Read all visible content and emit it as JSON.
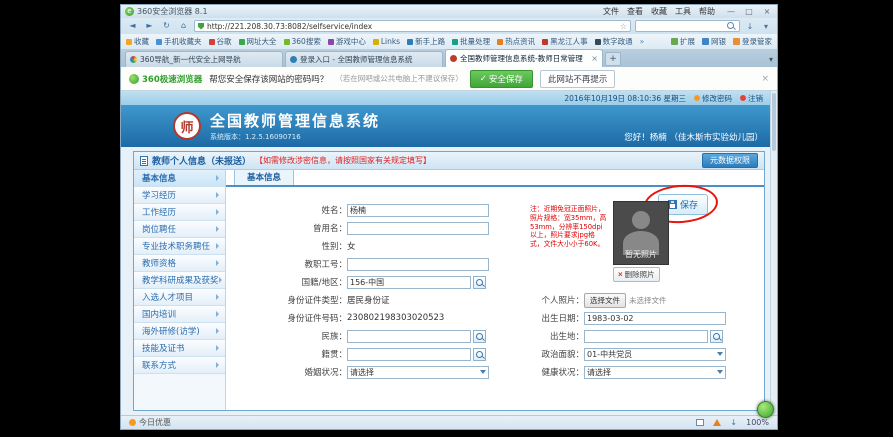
{
  "icons": {
    "back": "◄",
    "forward": "►",
    "refresh": "↻",
    "home": "⌂",
    "star": "☆",
    "min": "—",
    "max": "□",
    "close": "×",
    "plus": "+",
    "caret": "▾",
    "check": "✓",
    "x": "×",
    "download": "↓",
    "chevrons": "»"
  },
  "chrome": {
    "window_title": "360安全浏览器 8.1",
    "menus": [
      "文件",
      "查看",
      "收藏",
      "工具",
      "帮助"
    ],
    "url": "http://221.208.30.73:8082/selfservice/index",
    "bookmarks": [
      "收藏",
      "手机收藏夹",
      "谷歌",
      "网址大全",
      "360搜索",
      "游戏中心",
      "Links",
      "新手上路",
      "批量处理",
      "热点资讯",
      "黑龙江人事",
      "数字政通"
    ],
    "bookmark_tools": [
      "扩展",
      "网银",
      "登录管家"
    ],
    "tabs": [
      {
        "label": "360导航_新一代安全上网导航"
      },
      {
        "label": "登录入口 - 全国教师管理信息系统"
      },
      {
        "label": "全国教师管理信息系统-教师日常管理"
      }
    ],
    "notify": {
      "brand": "360极速浏览器",
      "message": "帮您安全保存该网站的密码吗？",
      "hint": "（若在网吧或公共电脑上不建议保存）",
      "save_btn": "安全保存",
      "dismiss_btn": "此网站不再提示"
    },
    "status_left": "今日优惠",
    "zoom": "100%"
  },
  "site": {
    "title": "全国教师管理信息系统",
    "version": "系统版本：1.2.5.16090716",
    "datetime": "2016年10月19日 08:10:36 星期三",
    "change_pwd": "修改密码",
    "logout": "注销",
    "welcome": "您好！杨楠 （佳木斯市实验幼儿园）"
  },
  "panel": {
    "title": "教师个人信息（未报送）",
    "notice": "【如需修改涉密信息，请按照国家有关规定填写】",
    "meta_btn": "元数据权限",
    "menu": [
      "基本信息",
      "学习经历",
      "工作经历",
      "岗位聘任",
      "专业技术职务聘任",
      "教师资格",
      "教学科研成果及获奖",
      "入选人才项目",
      "国内培训",
      "海外研修(访学)",
      "技能及证书",
      "联系方式"
    ],
    "tab": "基本信息",
    "save_btn": "保存",
    "file_btn": "选择文件",
    "photo": {
      "note": "注：近期免冠正面照片，照片规格：宽35mm，高53mm，分辨率150dpi以上，照片要求jpg格式，文件大小小于60K。",
      "placeholder": "暂无照片",
      "delete_btn": "删除照片"
    },
    "left_rows": [
      {
        "label": "姓名：",
        "value": "杨楠"
      },
      {
        "label": "曾用名：",
        "value": ""
      },
      {
        "label": "性别：",
        "value": "女"
      },
      {
        "label": "教职工号：",
        "value": ""
      },
      {
        "label": "国籍/地区：",
        "value": "156-中国"
      },
      {
        "label": "身份证件类型：",
        "value": "居民身份证"
      },
      {
        "label": "身份证件号码：",
        "value": "230802198303020523"
      },
      {
        "label": "民族：",
        "value": ""
      },
      {
        "label": "籍贯：",
        "value": ""
      },
      {
        "label": "婚姻状况：",
        "value": "请选择"
      }
    ],
    "right_rows": [
      {
        "label": "个人照片：",
        "value": "未选择文件"
      },
      {
        "label": "出生日期：",
        "value": "1983-03-02"
      },
      {
        "label": "出生地：",
        "value": ""
      },
      {
        "label": "政治面貌：",
        "value": "01-中共党员"
      },
      {
        "label": "健康状况：",
        "value": "请选择"
      }
    ]
  }
}
